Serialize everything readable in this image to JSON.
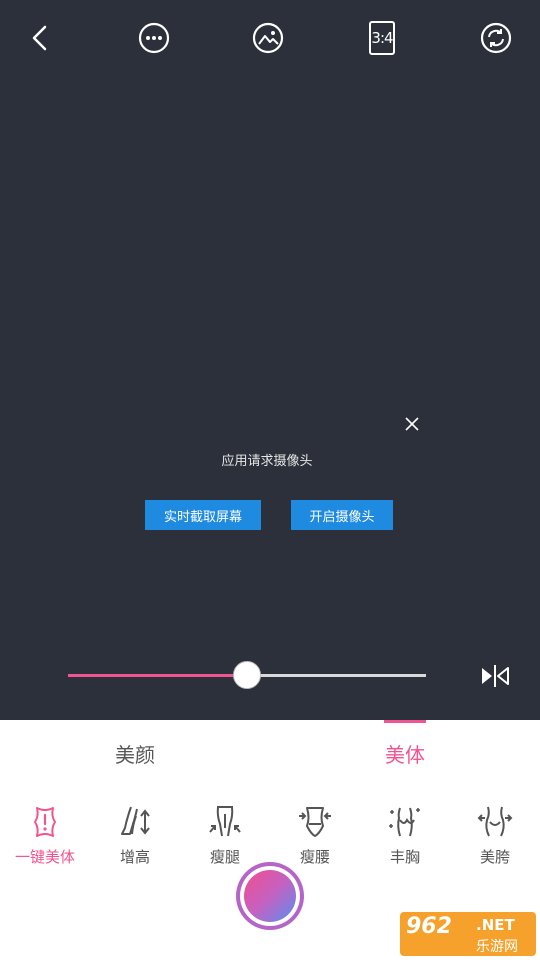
{
  "top_bar": {
    "back_icon": "chevron-left-icon",
    "more_icon": "more-circle-icon",
    "gallery_icon": "image-icon",
    "ratio_label": "3:4",
    "switch_camera_icon": "rotate-camera-icon"
  },
  "dialog": {
    "message": "应用请求摄像头",
    "screen_capture_label": "实时截取屏幕",
    "open_camera_label": "开启摄像头",
    "close_icon": "close-icon"
  },
  "slider": {
    "value": 0.5,
    "active_color": "#f05591"
  },
  "mirror_icon": "mirror-flip-icon",
  "tabs": [
    {
      "label": "美颜",
      "active": false
    },
    {
      "label": "美体",
      "active": true
    }
  ],
  "tools": [
    {
      "label": "一键美体",
      "icon": "body-shape-icon",
      "active": true
    },
    {
      "label": "增高",
      "icon": "leg-lengthen-icon",
      "active": false
    },
    {
      "label": "瘦腿",
      "icon": "slim-legs-icon",
      "active": false
    },
    {
      "label": "瘦腰",
      "icon": "slim-waist-icon",
      "active": false
    },
    {
      "label": "丰胸",
      "icon": "chest-enhance-icon",
      "active": false
    },
    {
      "label": "美胯",
      "icon": "hip-shape-icon",
      "active": false
    }
  ],
  "colors": {
    "accent": "#f05591",
    "button_blue": "#1e8ae0",
    "camera_bg": "#2b303a"
  },
  "watermark": {
    "number": "962",
    "net": ".NET",
    "site": "乐游网"
  }
}
